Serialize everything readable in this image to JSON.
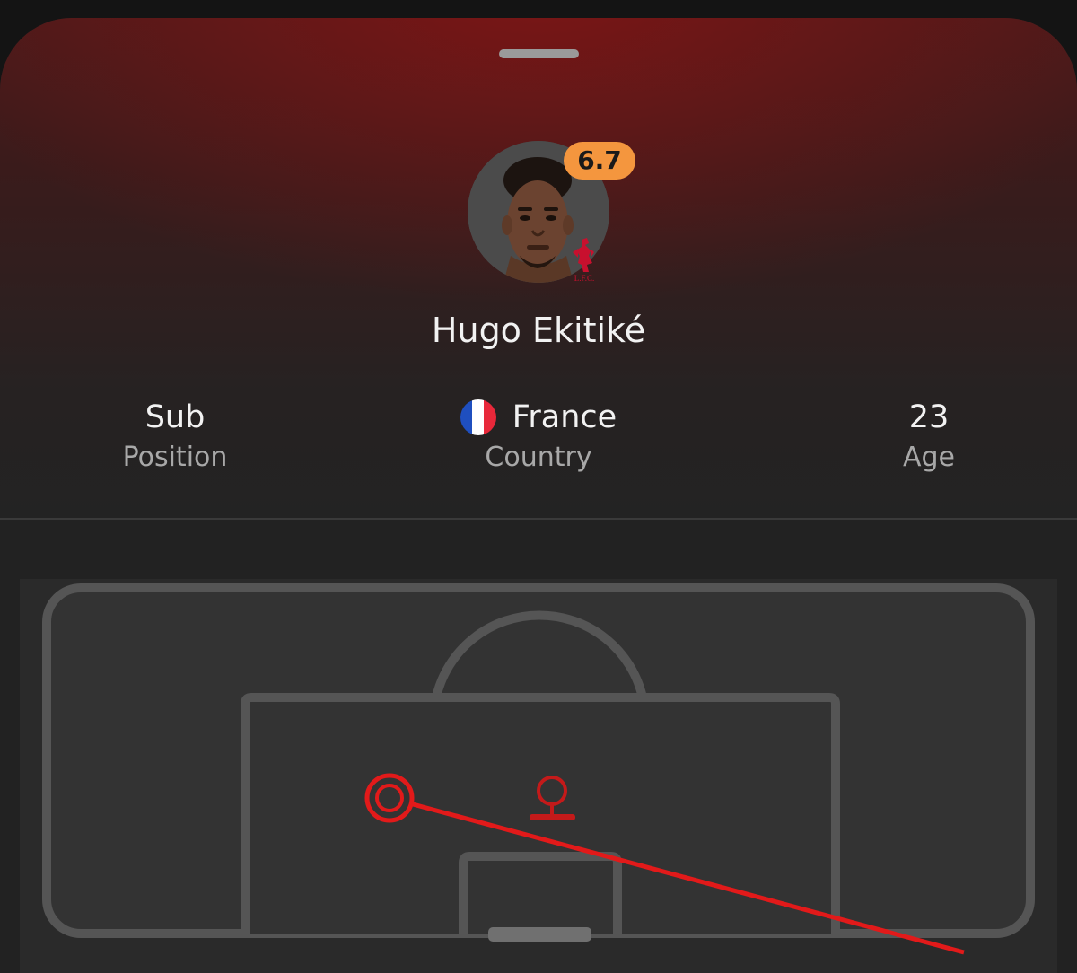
{
  "player": {
    "name": "Hugo Ekitiké",
    "rating": "6.7",
    "club_crest_text": "L.F.C."
  },
  "stats": {
    "position": {
      "value": "Sub",
      "label": "Position"
    },
    "country": {
      "value": "France",
      "label": "Country",
      "flag_colors": [
        "#1f4fbf",
        "#ffffff",
        "#e8283a"
      ]
    },
    "age": {
      "value": "23",
      "label": "Age"
    }
  },
  "colors": {
    "accent": "#e21a1a",
    "rating_badge": "#f4963e",
    "pitch_lines": "#555555"
  },
  "shot_map": {
    "shot_marker": "target-ring-icon",
    "goalkeeper_marker": "goalkeeper-icon"
  }
}
